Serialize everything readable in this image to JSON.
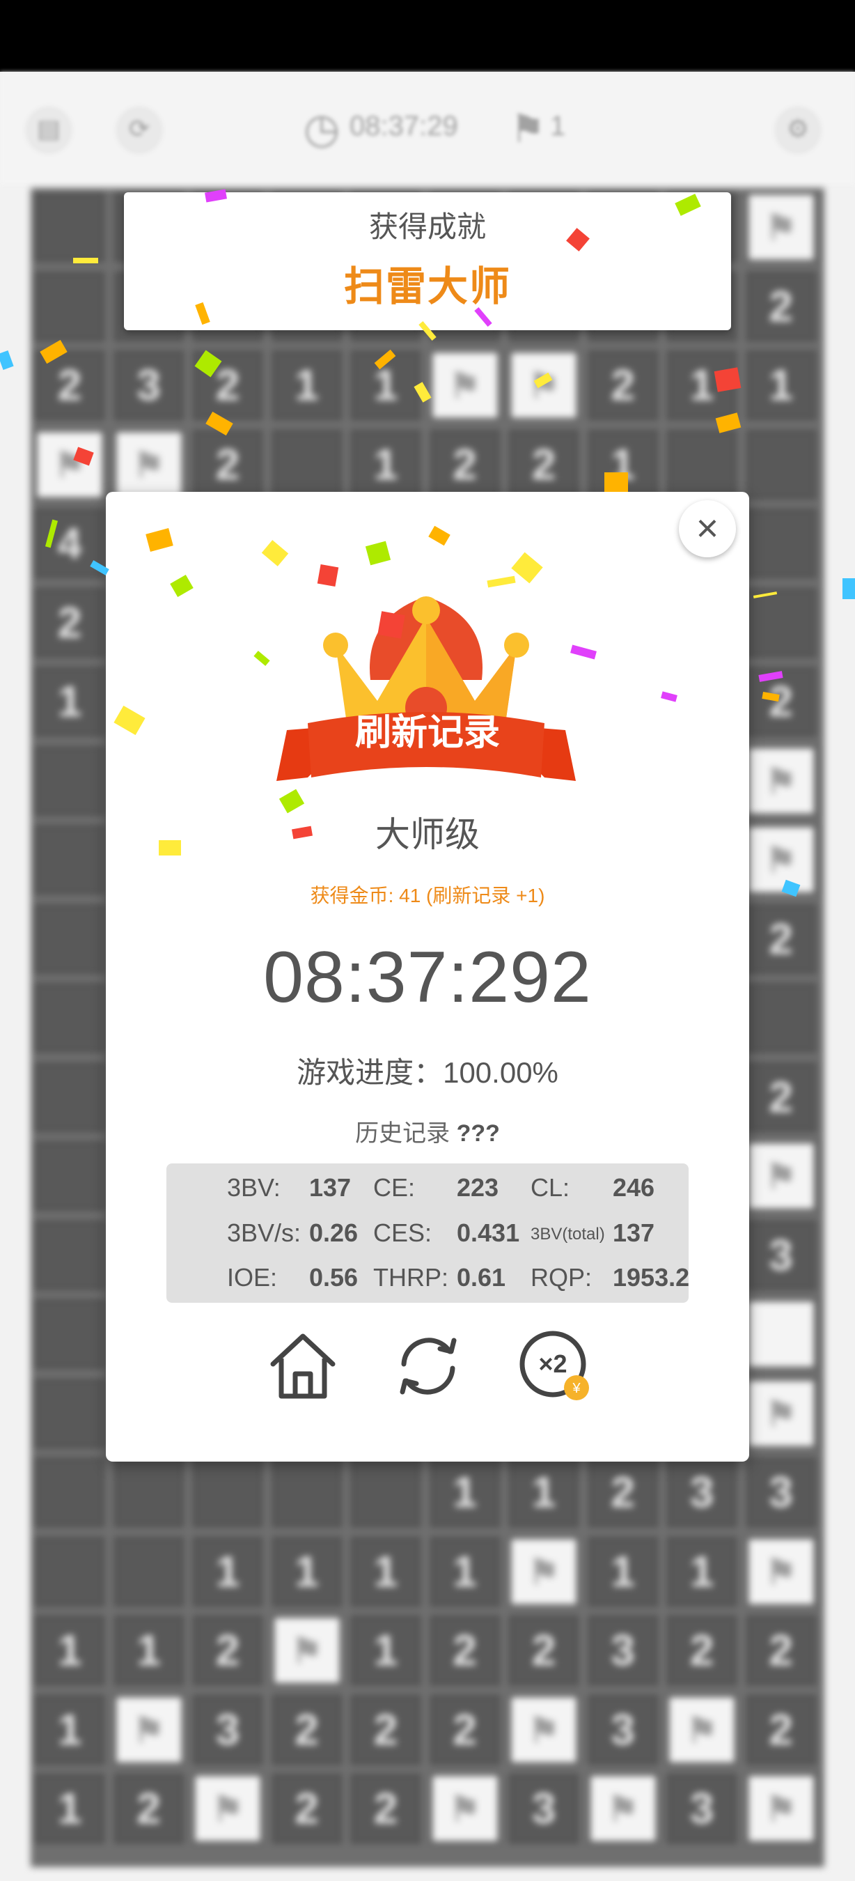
{
  "toolbar": {
    "timer": "08:37:29",
    "flags": "1",
    "icons": [
      "save-icon",
      "restart-icon",
      "clock-icon",
      "flag-icon",
      "settings-icon"
    ]
  },
  "board": {
    "rows": [
      [
        "",
        "",
        "",
        "",
        "",
        "",
        "",
        "",
        "",
        "F"
      ],
      [
        "",
        "",
        "",
        "",
        "",
        "",
        "",
        "",
        "",
        "2"
      ],
      [
        "2",
        "3",
        "2",
        "1",
        "1",
        "F",
        "F",
        "2",
        "1",
        "1"
      ],
      [
        "F",
        "F",
        "2",
        "",
        "1",
        "2",
        "2",
        "1",
        "",
        ""
      ],
      [
        "4",
        "",
        "",
        "",
        "",
        "",
        "",
        "",
        "",
        ""
      ],
      [
        "2",
        "",
        "",
        "",
        "",
        "",
        "",
        "",
        "",
        ""
      ],
      [
        "1",
        "",
        "",
        "",
        "",
        "",
        "",
        "",
        "",
        "2"
      ],
      [
        "",
        "",
        "",
        "",
        "",
        "",
        "",
        "",
        "",
        "F"
      ],
      [
        "",
        "",
        "",
        "",
        "",
        "",
        "",
        "",
        "",
        "F"
      ],
      [
        "",
        "",
        "",
        "",
        "",
        "",
        "",
        "",
        "",
        "2"
      ],
      [
        "",
        "",
        "",
        "",
        "",
        "",
        "",
        "",
        "",
        ""
      ],
      [
        "",
        "",
        "",
        "",
        "",
        "",
        "",
        "",
        "",
        "2"
      ],
      [
        "",
        "",
        "",
        "",
        "",
        "",
        "",
        "",
        "",
        "F"
      ],
      [
        "",
        "",
        "",
        "",
        "",
        "",
        "",
        "",
        "",
        "3"
      ],
      [
        "",
        "",
        "",
        "",
        "",
        "",
        "",
        "",
        "",
        "O"
      ],
      [
        "",
        "",
        "",
        "",
        "",
        "",
        "",
        "",
        "",
        "F"
      ],
      [
        "",
        "",
        "",
        "",
        "",
        "1",
        "1",
        "2",
        "3",
        "3"
      ],
      [
        "",
        "",
        "1",
        "1",
        "1",
        "1",
        "F",
        "1",
        "1",
        "F"
      ],
      [
        "1",
        "1",
        "2",
        "F",
        "1",
        "2",
        "2",
        "3",
        "2",
        "2"
      ],
      [
        "1",
        "F",
        "3",
        "2",
        "2",
        "2",
        "F",
        "3",
        "F",
        "2"
      ],
      [
        "1",
        "2",
        "F",
        "2",
        "2",
        "F",
        "3",
        "F",
        "3",
        "F"
      ]
    ]
  },
  "achievement": {
    "title": "获得成就",
    "name": "扫雷大师"
  },
  "result": {
    "banner": "刷新记录",
    "level": "大师级",
    "coins": "获得金币: 41 (刷新记录 +1)",
    "time": "08:37:292",
    "progress": "游戏进度：100.00%",
    "history_label": "历史记录",
    "history_value": "???",
    "stats": [
      {
        "label": "3BV:",
        "value": "137"
      },
      {
        "label": "CE:",
        "value": "223"
      },
      {
        "label": "CL:",
        "value": "246"
      },
      {
        "label": "3BV/s:",
        "value": "0.26"
      },
      {
        "label": "CES:",
        "value": "0.431"
      },
      {
        "label": "3BV(total)",
        "value": "137"
      },
      {
        "label": "IOE:",
        "value": "0.56"
      },
      {
        "label": "THRP:",
        "value": "0.61"
      },
      {
        "label": "RQP:",
        "value": "1953.2"
      }
    ],
    "actions": [
      "home-icon",
      "replay-icon",
      "double-coins-icon"
    ],
    "double_label": "×2",
    "coin_symbol": "¥"
  },
  "colors": {
    "accent": "#ee8a18",
    "banner": "#e63a12",
    "text": "#555555"
  }
}
